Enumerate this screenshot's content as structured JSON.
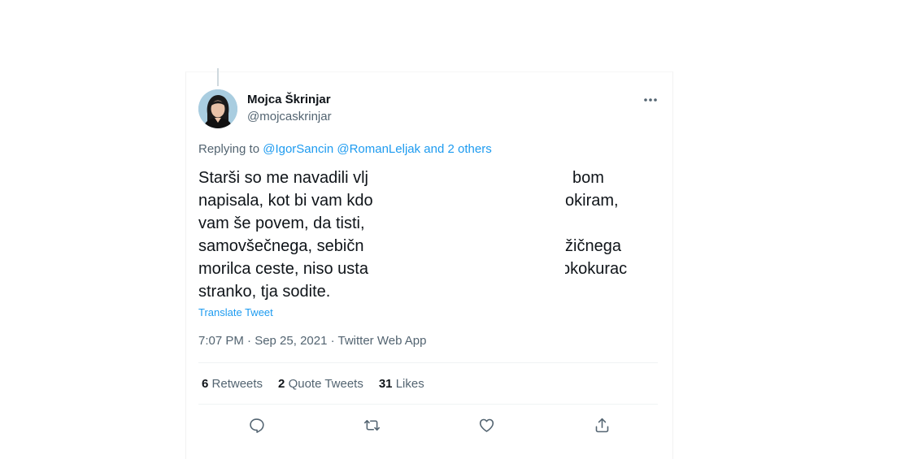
{
  "author": {
    "display_name": "Mojca Škrinjar",
    "handle": "@mojcaskrinjar",
    "avatar_icon": "profile-photo"
  },
  "more_icon": "more-horizontal-icon",
  "reply": {
    "prefix": "Replying to ",
    "mention_1": "@IgorSancin",
    "mention_2": "@RomanLeljak",
    "others": "and 2 others"
  },
  "tweet": {
    "lines": [
      "Starši so me navadili vlj          bom",
      "napisala, kot bi vam kdo          okiram,",
      "vam še povem, da tisti,",
      "samovšečnega,  sebičn          žičnega",
      "morilca ceste, niso usta          okokurac",
      "stranko,  tja sodite."
    ],
    "fragments": {
      "l1a": "Starši so me navadili vlj",
      "l1b": "bom",
      "l2a": "napisala, kot bi vam kdo",
      "l2b": "okiram,",
      "l3a": "vam še povem, da tisti,",
      "l4a": "samovšečnega,  sebičn",
      "l4b": "žičnega",
      "l5a": "morilca ceste, niso usta",
      "l5b": "okokurac",
      "l6a": "stranko,  tja sodite."
    }
  },
  "translate_label": "Translate Tweet",
  "meta": "7:07 PM · Sep 25, 2021 · Twitter Web App",
  "stats": {
    "retweets_count": "6",
    "retweets_label": "Retweets",
    "quotes_count": "2",
    "quotes_label": "Quote Tweets",
    "likes_count": "31",
    "likes_label": "Likes"
  },
  "actions": [
    "reply-icon",
    "retweet-icon",
    "like-icon",
    "share-icon"
  ],
  "colors": {
    "link": "#1d9bf0",
    "secondary_text": "#536471",
    "primary_text": "#0f1419",
    "divider": "#eff3f4"
  }
}
